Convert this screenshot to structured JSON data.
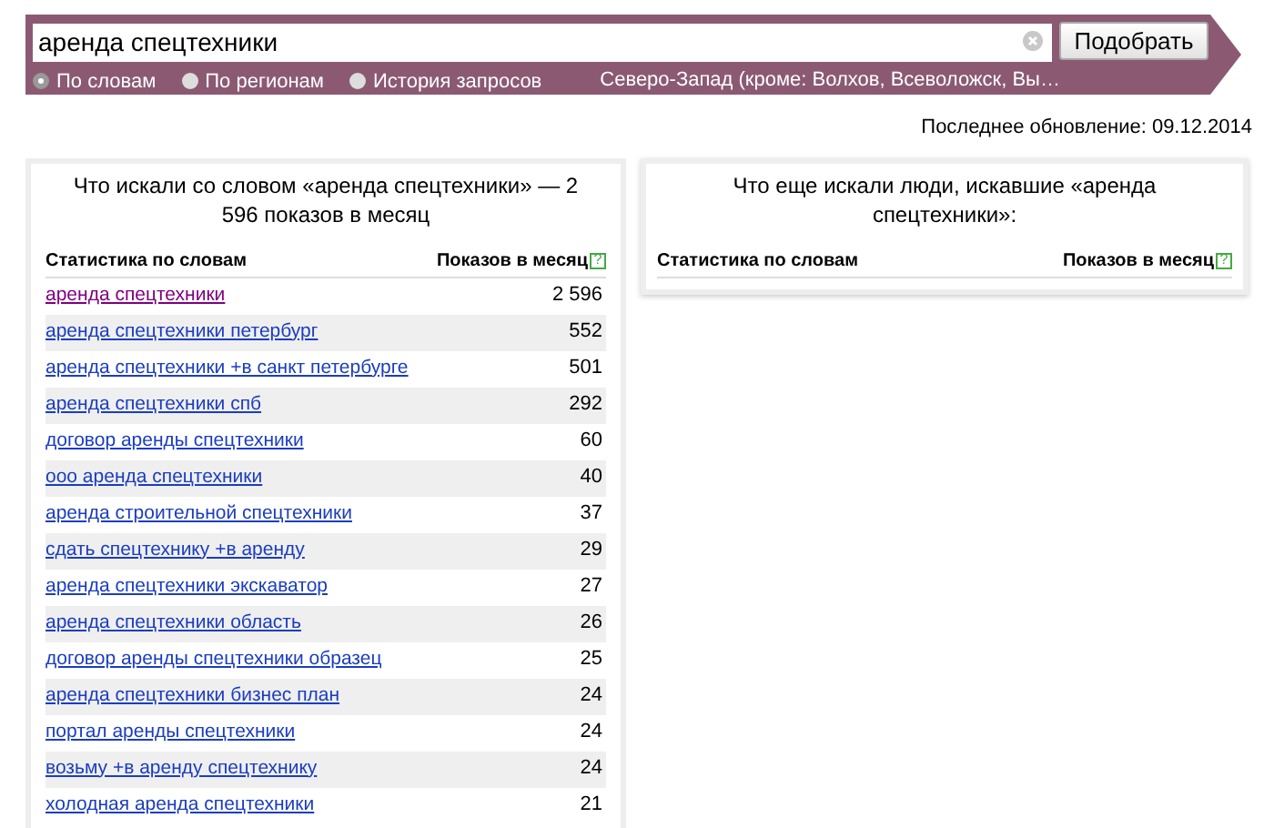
{
  "search": {
    "value": "аренда спецтехники",
    "button": "Подобрать"
  },
  "modes": [
    {
      "label": "По словам",
      "selected": true
    },
    {
      "label": "По регионам",
      "selected": false
    },
    {
      "label": "История запросов",
      "selected": false
    }
  ],
  "region": "Северо-Запад (кроме: Волхов, Всеволожск, Вы…",
  "last_update": "Последнее обновление: 09.12.2014",
  "left_panel": {
    "title": "Что искали со словом «аренда спецтехники» — 2 596 показов в месяц",
    "columns": [
      "Статистика по словам",
      "Показов в месяц"
    ],
    "help": "?",
    "rows": [
      {
        "phrase": "аренда спецтехники",
        "count": "2 596",
        "visited": true
      },
      {
        "phrase": "аренда спецтехники петербург",
        "count": "552",
        "visited": false
      },
      {
        "phrase": "аренда спецтехники +в санкт петербурге",
        "count": "501",
        "visited": false
      },
      {
        "phrase": "аренда спецтехники спб",
        "count": "292",
        "visited": false
      },
      {
        "phrase": "договор аренды спецтехники",
        "count": "60",
        "visited": false
      },
      {
        "phrase": "ооо аренда спецтехники",
        "count": "40",
        "visited": false
      },
      {
        "phrase": "аренда строительной спецтехники",
        "count": "37",
        "visited": false
      },
      {
        "phrase": "сдать спецтехнику +в аренду",
        "count": "29",
        "visited": false
      },
      {
        "phrase": "аренда спецтехники экскаватор",
        "count": "27",
        "visited": false
      },
      {
        "phrase": "аренда спецтехники область",
        "count": "26",
        "visited": false
      },
      {
        "phrase": "договор аренды спецтехники образец",
        "count": "25",
        "visited": false
      },
      {
        "phrase": "аренда спецтехники бизнес план",
        "count": "24",
        "visited": false
      },
      {
        "phrase": "портал аренды спецтехники",
        "count": "24",
        "visited": false
      },
      {
        "phrase": "возьму +в аренду спецтехнику",
        "count": "24",
        "visited": false
      },
      {
        "phrase": "холодная аренда спецтехники",
        "count": "21",
        "visited": false
      }
    ]
  },
  "right_panel": {
    "title": "Что еще искали люди, искавшие «аренда спецтехники»:",
    "columns": [
      "Статистика по словам",
      "Показов в месяц"
    ],
    "help": "?"
  }
}
